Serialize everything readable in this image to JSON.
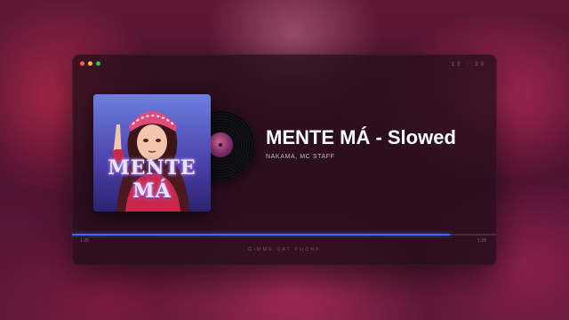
{
  "window": {
    "clock": "13 : 30"
  },
  "track": {
    "cover_text": "MENTE MÁ",
    "title": "MENTE MÁ - Slowed",
    "artist": "NAKAMA, MC STAFF"
  },
  "progress": {
    "elapsed": "1:28",
    "total": "1:28",
    "fraction": 0.89,
    "accent_color": "#3a6cff"
  },
  "channel": {
    "name": "GIMME DAT PHONK"
  }
}
